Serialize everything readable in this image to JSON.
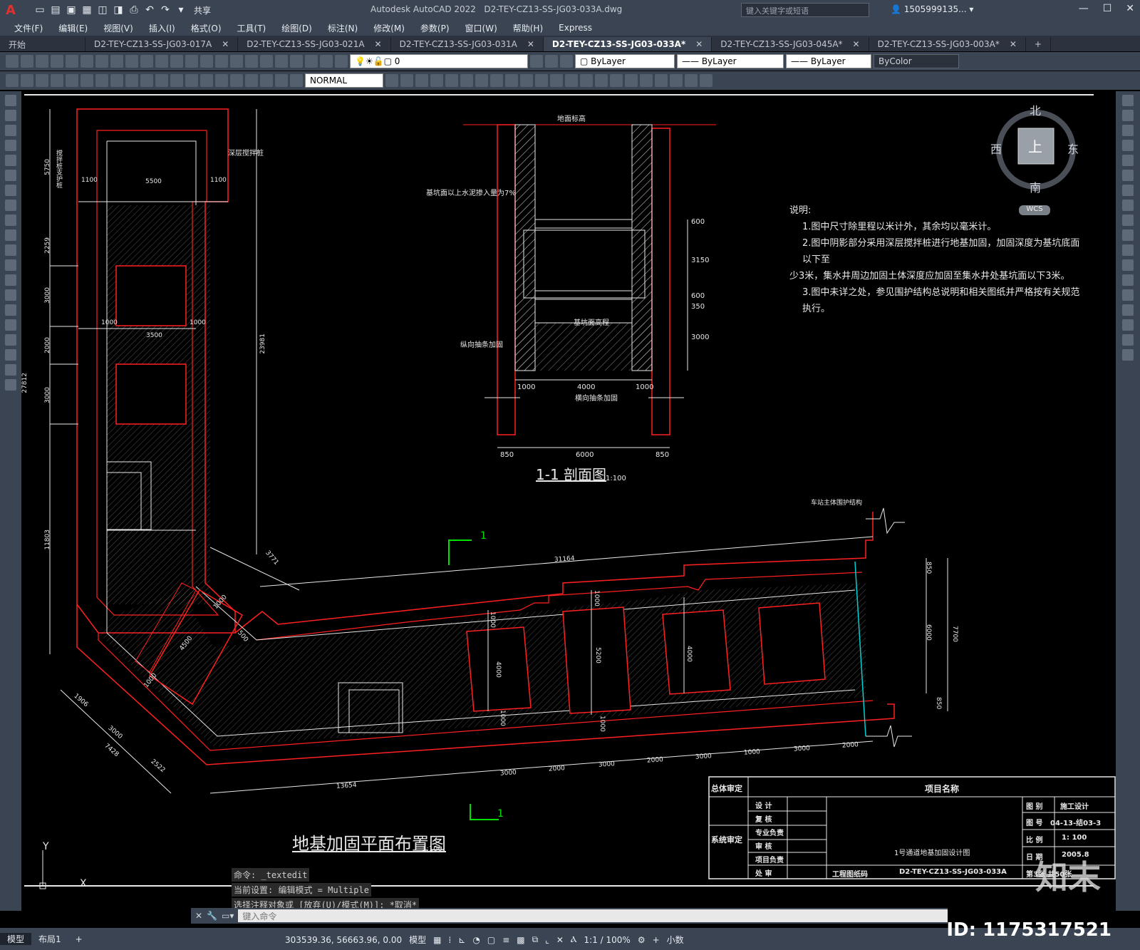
{
  "app": {
    "title": "Autodesk AutoCAD 2022",
    "file": "D2-TEY-CZ13-SS-JG03-033A.dwg"
  },
  "quick_access": {
    "share_label": "共享"
  },
  "search": {
    "placeholder": "键入关键字或短语"
  },
  "user": {
    "name": "1505999135... ▾"
  },
  "menu": [
    "文件(F)",
    "编辑(E)",
    "视图(V)",
    "插入(I)",
    "格式(O)",
    "工具(T)",
    "绘图(D)",
    "标注(N)",
    "修改(M)",
    "参数(P)",
    "窗口(W)",
    "帮助(H)",
    "Express"
  ],
  "tabs": [
    {
      "label": "开始"
    },
    {
      "label": "D2-TEY-CZ13-SS-JG03-017A"
    },
    {
      "label": "D2-TEY-CZ13-SS-JG03-021A"
    },
    {
      "label": "D2-TEY-CZ13-SS-JG03-031A"
    },
    {
      "label": "D2-TEY-CZ13-SS-JG03-033A*"
    },
    {
      "label": "D2-TEY-CZ13-SS-JG03-045A*"
    },
    {
      "label": "D2-TEY-CZ13-SS-JG03-003A*"
    }
  ],
  "properties": {
    "layer": "0",
    "color": "ByLayer",
    "linetype": "ByLayer",
    "lineweight": "ByLayer",
    "plotstyle": "ByColor",
    "dimstyle": "NORMAL"
  },
  "viewcube": {
    "north": "北",
    "south": "南",
    "east": "东",
    "west": "西",
    "top": "上",
    "wcs": "WCS"
  },
  "notes": {
    "title": "说明:",
    "lines": [
      "1.图中尺寸除里程以米计外，其余均以毫米计。",
      "2.图中阴影部分采用深层搅拌桩进行地基加固，加固深度为基坑底面以下至",
      "少3米，集水井周边加固土体深度应加固至集水井处基坑面以下3米。",
      "3.图中未详之处，参见围护结构总说明和相关图纸并严格按有关规范执行。"
    ]
  },
  "section": {
    "title": "1-1  剖面图",
    "scale": "1:100",
    "ground": "地面标高",
    "pit_bottom": "基坑面高程",
    "label_cement": "基坑面以上水泥掺入量为7%",
    "label_long": "纵向抽条加固",
    "label_cross": "横向抽条加固",
    "dims_bottom": [
      "1000",
      "4000",
      "1000"
    ],
    "dims_total": [
      "850",
      "6000",
      "850"
    ],
    "dims_right": [
      "600",
      "3150",
      "600",
      "350",
      "3000"
    ]
  },
  "plan": {
    "title": "地基加固平面布置图",
    "scale": "1:100",
    "label_mixing": "深层搅拌桩",
    "label_retain": "搅拌桩支护桩",
    "label_station": "车站主体围护结构",
    "section_mark": "1",
    "dims": {
      "top": [
        "1100",
        "5500",
        "1100"
      ],
      "mid": [
        "1000",
        "3500",
        "1000"
      ],
      "left": [
        "5750",
        "2259",
        "3000",
        "2000",
        "3000",
        "11803",
        "27812"
      ],
      "long": "23981",
      "diag": [
        "3771",
        "1000",
        "500",
        "4500",
        "1000",
        "1906",
        "3000",
        "7428",
        "2522"
      ],
      "run_top": "31164",
      "run_bottom": "13654",
      "bottom_chain": [
        "3000",
        "2000",
        "3000",
        "2000",
        "3000",
        "1000",
        "3000",
        "2000"
      ],
      "right": [
        "850",
        "6000",
        "850",
        "7700"
      ],
      "pits": [
        "1000",
        "4000",
        "1000",
        "5200",
        "1000",
        "1000",
        "4000"
      ]
    }
  },
  "titleblock": {
    "review_total": "总体审定",
    "review_system": "系统审定",
    "project_name": "项目名称",
    "roles": [
      "设  计",
      "复  核",
      "专业负责",
      "审  核",
      "项目负责",
      "处  审"
    ],
    "drawing_name": "1号通道地基加固设计图",
    "phase_label": "图  别",
    "phase": "施工设计",
    "no_label": "图  号",
    "no": "04-13-结03-3",
    "scale_label": "比  例",
    "scale": "1: 100",
    "date_label": "日  期",
    "date": "2005.8",
    "sheet": "第3张  共50张",
    "code_label": "工程图纸码",
    "code": "D2-TEY-CZ13-SS-JG03-033A"
  },
  "command": {
    "history": [
      "命令: _textedit",
      "当前设置: 编辑模式 = Multiple",
      "选择注释对象或 [放弃(U)/模式(M)]: *取消*"
    ],
    "placeholder": "键入命令"
  },
  "status": {
    "layouts": [
      "模型",
      "布局1",
      "+"
    ],
    "coords": "303539.36, 56663.96, 0.00",
    "mode": "模型",
    "scale": "1:1 / 100%",
    "units": "小数"
  },
  "watermark": {
    "brand": "知末",
    "id": "ID: 1175317521"
  },
  "colors": {
    "red": "#ff2020",
    "white": "#e8e8e8",
    "green": "#00e000",
    "cyan": "#00d0d0"
  }
}
